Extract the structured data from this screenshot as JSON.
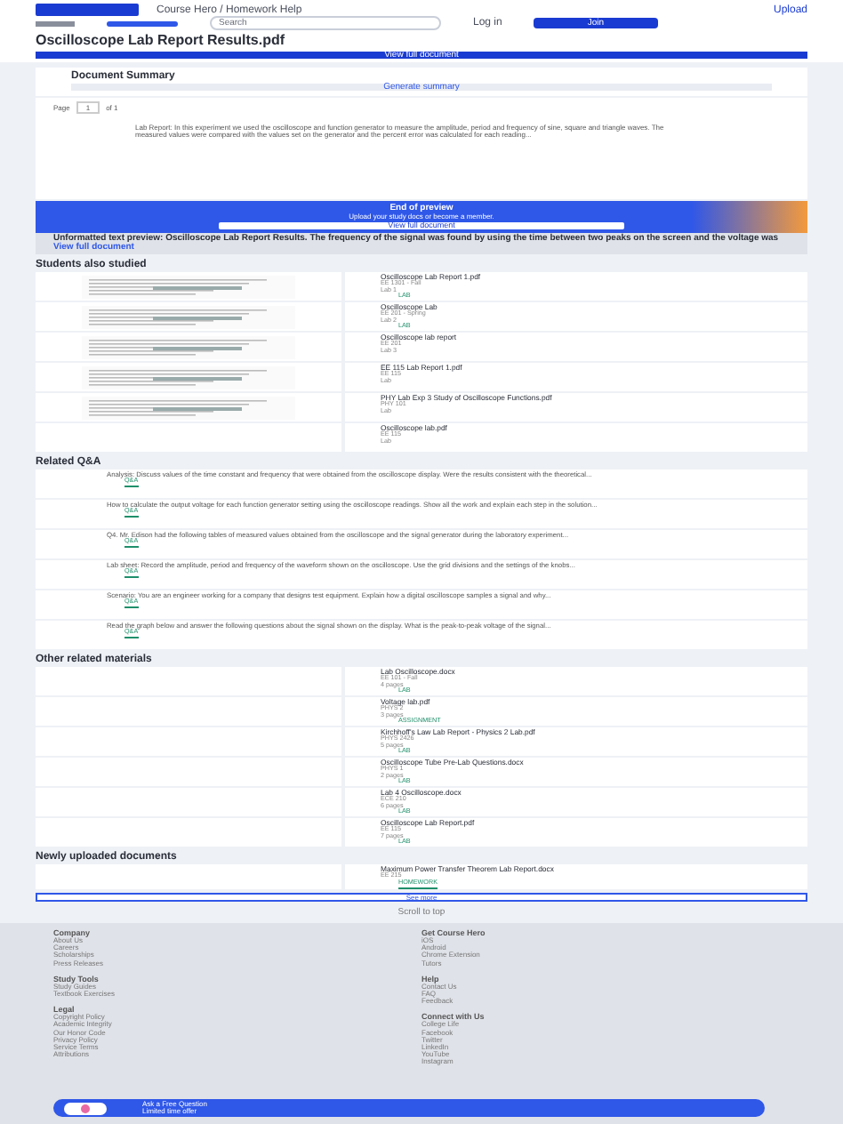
{
  "header": {
    "breadcrumb": "Course Hero / Homework Help",
    "upload": "Upload",
    "search_placeholder": "Search",
    "login": "Log in",
    "join": "Join"
  },
  "document": {
    "title": "Oscilloscope Lab Report Results.pdf",
    "view_full": "View full document",
    "summary_title": "Document Summary",
    "generate": "Generate summary",
    "page_label": "Page",
    "page_value": "1",
    "page_total": "of 1",
    "preview_text": "Lab Report: In this experiment we used the oscilloscope and function generator to measure the amplitude, period and frequency of sine, square and triangle waves. The measured values were compared with the values set on the generator and the percent error was calculated for each reading..."
  },
  "end_preview": {
    "title": "End of preview",
    "subtitle": "Upload your study docs or become a member.",
    "button": "View full document"
  },
  "unformatted": {
    "text": "Unformatted text preview: Oscilloscope Lab Report Results. The frequency of the signal was found by using the time between two peaks on the screen and the voltage was",
    "link": "View full document"
  },
  "students_also_studied": {
    "heading": "Students also studied",
    "items": [
      {
        "title": "Oscilloscope Lab Report 1.pdf",
        "course": "EE 1301 - Fall",
        "pages": "Lab 1",
        "tag": "LAB",
        "thumbnail": true
      },
      {
        "title": "Oscilloscope Lab",
        "course": "EE 201 - Spring",
        "pages": "Lab 2",
        "tag": "LAB",
        "thumbnail": true
      },
      {
        "title": "Oscilloscope lab report",
        "course": "EE 201",
        "pages": "Lab 3",
        "thumbnail": true
      },
      {
        "title": "EE 115 Lab Report 1.pdf",
        "course": "EE 115",
        "pages": "Lab",
        "thumbnail": true
      },
      {
        "title": "PHY Lab Exp 3 Study of Oscilloscope Functions.pdf",
        "course": "PHY 101",
        "pages": "Lab",
        "thumbnail": true
      },
      {
        "title": "Oscilloscope lab.pdf",
        "course": "EE 115",
        "pages": "Lab",
        "thumbnail": false
      }
    ]
  },
  "related_qa": {
    "heading": "Related Q&A",
    "items": [
      {
        "text": "Analysis: Discuss values of the time constant and frequency that were obtained from the oscilloscope display. Were the results consistent with the theoretical...",
        "tag": "Q&A"
      },
      {
        "text": "How to calculate the output voltage for each function generator setting using the oscilloscope readings. Show all the work and explain each step in the solution...",
        "tag": "Q&A"
      },
      {
        "text": "Q4. Mr. Edison had the following tables of measured values obtained from the oscilloscope and the signal generator during the laboratory experiment...",
        "tag": "Q&A"
      },
      {
        "text": "Lab sheet: Record the amplitude, period and frequency of the waveform shown on the oscilloscope. Use the grid divisions and the settings of the knobs...",
        "tag": "Q&A"
      },
      {
        "text": "Scenario: You are an engineer working for a company that designs test equipment. Explain how a digital oscilloscope samples a signal and why...",
        "tag": "Q&A"
      },
      {
        "text": "Read the graph below and answer the following questions about the signal shown on the display. What is the peak-to-peak voltage of the signal...",
        "tag": "Q&A"
      }
    ]
  },
  "other_materials": {
    "heading": "Other related materials",
    "items": [
      {
        "title": "Lab Oscilloscope.docx",
        "course": "EE 101 - Fall",
        "pages": "4 pages",
        "tag": "LAB"
      },
      {
        "title": "Voltage lab.pdf",
        "course": "PHYS 2",
        "pages": "3 pages",
        "tag": "ASSIGNMENT"
      },
      {
        "title": "Kirchhoff's Law Lab Report - Physics 2 Lab.pdf",
        "course": "PHYS 2426",
        "pages": "5 pages",
        "tag": "LAB"
      },
      {
        "title": "Oscilloscope Tube Pre-Lab Questions.docx",
        "course": "PHYS 1",
        "pages": "2 pages",
        "tag": "LAB"
      },
      {
        "title": "Lab 4 Oscilloscope.docx",
        "course": "ECE 210",
        "pages": "6 pages",
        "tag": "LAB"
      },
      {
        "title": "Oscilloscope Lab Report.pdf",
        "course": "EE 115",
        "pages": "7 pages",
        "tag": "LAB"
      }
    ]
  },
  "newly_uploaded": {
    "heading": "Newly uploaded documents",
    "items": [
      {
        "title": "Maximum Power Transfer Theorem Lab Report.docx",
        "course": "EE 215",
        "tag": "HOMEWORK"
      }
    ]
  },
  "see_more": "See more",
  "scroll_top": "Scroll to top",
  "footer": {
    "columns": [
      [
        {
          "heading": "Company",
          "links": [
            "About Us",
            "Careers",
            "Scholarships",
            "Press Releases"
          ]
        },
        {
          "heading": "Study Tools",
          "links": [
            "Study Guides",
            "Textbook Exercises"
          ]
        },
        {
          "heading": "Legal",
          "links": [
            "Copyright Policy",
            "Academic Integrity",
            "Our Honor Code",
            "Privacy Policy",
            "Service Terms",
            "Attributions"
          ]
        }
      ],
      [
        {
          "heading": "Get Course Hero",
          "links": [
            "iOS",
            "Android",
            "Chrome Extension",
            "Tutors"
          ]
        },
        {
          "heading": "Help",
          "links": [
            "Contact Us",
            "FAQ",
            "Feedback"
          ]
        },
        {
          "heading": "Connect with Us",
          "links": [
            "College Life",
            "Facebook",
            "Twitter",
            "LinkedIn",
            "YouTube",
            "Instagram"
          ]
        }
      ]
    ]
  },
  "ask_bar": {
    "title": "Ask a Free Question",
    "subtitle": "Limited time offer"
  }
}
